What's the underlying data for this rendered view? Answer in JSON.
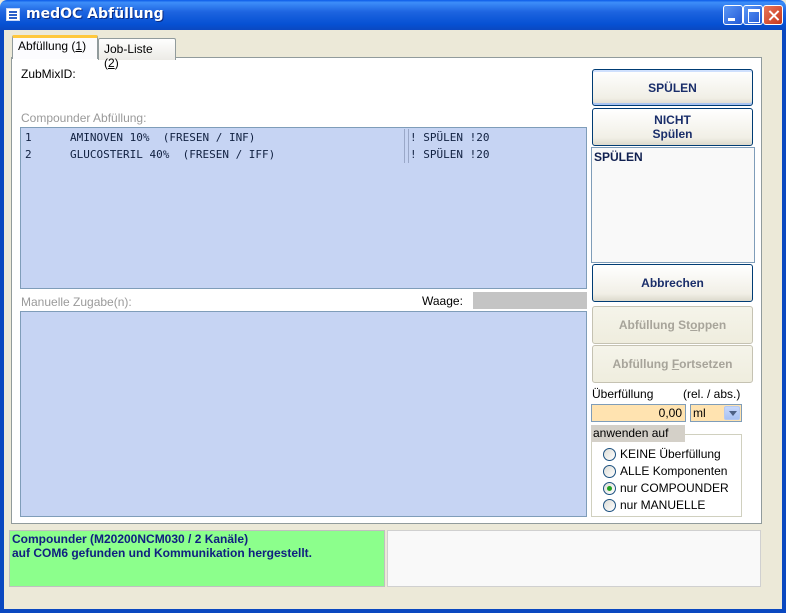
{
  "window": {
    "title": "medOC Abfüllung"
  },
  "tabs": [
    {
      "label_pre": "Abfüllung (",
      "key": "1",
      "label_post": ")"
    },
    {
      "label_pre": "Job-Liste (",
      "key": "2",
      "label_post": ")"
    }
  ],
  "form": {
    "zubmix_label": "ZubMixID:",
    "compounder_label": "Compounder Abfüllung:",
    "manuelle_label": "Manuelle Zugabe(n):",
    "waage_label": "Waage:",
    "compounder_rows": [
      {
        "num": "1",
        "name": "AMINOVEN 10%  (FRESEN / INF)",
        "action": "! SPÜLEN !20"
      },
      {
        "num": "2",
        "name": "GLUCOSTERIL 40%  (FRESEN / IFF)",
        "action": "! SPÜLEN !20"
      }
    ]
  },
  "side": {
    "spuelen_button": "SPÜLEN",
    "nicht_line1": "NICHT",
    "nicht_line2": "Spülen",
    "info_text": "SPÜLEN",
    "abbrechen_button": "Abbrechen",
    "stoppen_pre": "Abfüllung St",
    "stoppen_key": "o",
    "stoppen_post": "ppen",
    "fortsetzen_pre": "Abfüllung ",
    "fortsetzen_key": "F",
    "fortsetzen_post": "ortsetzen",
    "ueberfuellung_label": "Überfüllung",
    "rel_abs_label": "(rel. / abs.)",
    "ueberfuellung_value": "0,00",
    "unit_value": "ml",
    "anwenden_label": "anwenden auf",
    "radio_options": [
      "KEINE Überfüllung",
      "ALLE Komponenten",
      "nur COMPOUNDER",
      "nur MANUELLE"
    ],
    "radio_selected": "nur COMPOUNDER"
  },
  "status": {
    "line1": "Compounder (M20200NCM030  / 2 Kanäle)",
    "line2": "auf COM6 gefunden und Kommunikation hergestellt."
  },
  "colors": {
    "listbox": "#c6d4f3",
    "status_ok": "#8cff8c",
    "input_highlight": "#ffe3b0"
  }
}
